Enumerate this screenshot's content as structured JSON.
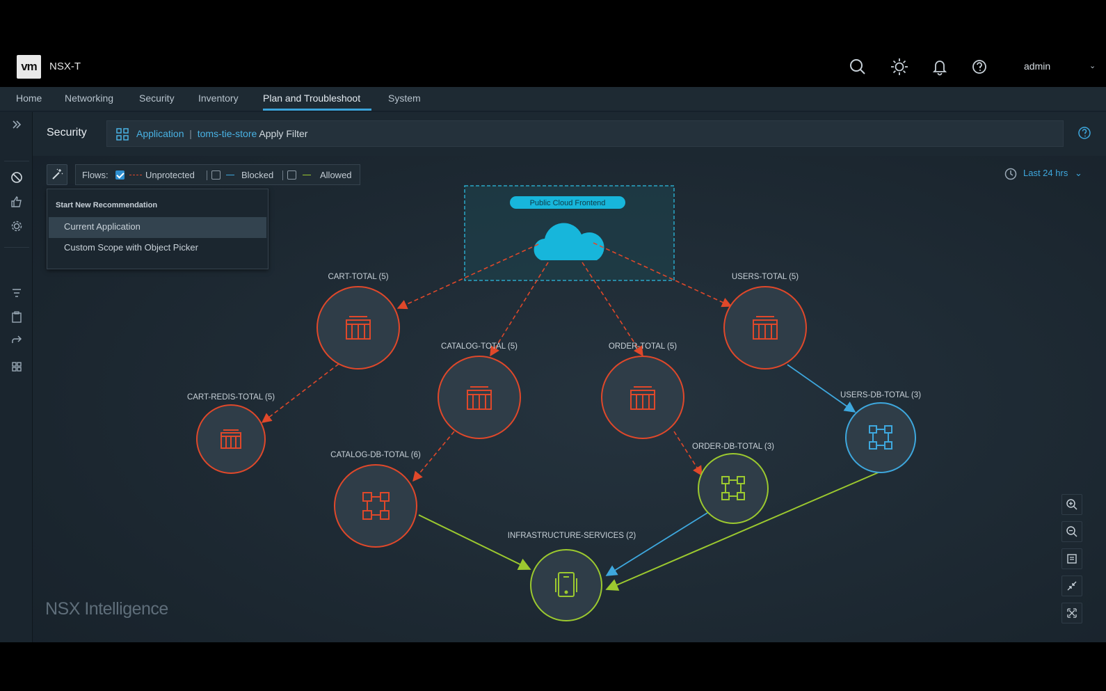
{
  "header": {
    "logo_text": "vm",
    "product": "NSX-T",
    "user": "admin",
    "icons": [
      "search-icon",
      "theme-icon",
      "bell-icon",
      "help-icon"
    ]
  },
  "nav": {
    "items": [
      {
        "label": "Home"
      },
      {
        "label": "Networking"
      },
      {
        "label": "Security"
      },
      {
        "label": "Inventory"
      },
      {
        "label": "Plan and Troubleshoot"
      },
      {
        "label": "System"
      }
    ],
    "active": "Plan and Troubleshoot"
  },
  "breadcrumb": {
    "title": "Security",
    "filter_application": "Application",
    "filter_value": "toms-tie-store",
    "apply_label": "Apply Filter"
  },
  "flows": {
    "label": "Flows:",
    "unprotected": {
      "label": "Unprotected",
      "checked": true,
      "color": "#e0482a"
    },
    "blocked": {
      "label": "Blocked",
      "checked": false,
      "color": "#3ea8de"
    },
    "allowed": {
      "label": "Allowed",
      "checked": false,
      "color": "#9cc92f"
    }
  },
  "time_range": "Last 24 hrs",
  "dropdown": {
    "header": "Start New Recommendation",
    "items": [
      {
        "label": "Current Application",
        "selected": true
      },
      {
        "label": "Custom Scope with Object Picker",
        "selected": false
      }
    ]
  },
  "graph": {
    "cloud_group_label": "Public Cloud Frontend",
    "nodes": [
      {
        "id": "cart",
        "label": "CART-TOTAL (5)",
        "kind": "vm",
        "status": "unprotected"
      },
      {
        "id": "users",
        "label": "USERS-TOTAL (5)",
        "kind": "vm",
        "status": "unprotected"
      },
      {
        "id": "catalog",
        "label": "CATALOG-TOTAL (5)",
        "kind": "vm",
        "status": "unprotected"
      },
      {
        "id": "order",
        "label": "ORDER-TOTAL (5)",
        "kind": "vm",
        "status": "unprotected"
      },
      {
        "id": "cartredis",
        "label": "CART-REDIS-TOTAL (5)",
        "kind": "vm",
        "status": "unprotected"
      },
      {
        "id": "usersdb",
        "label": "USERS-DB-TOTAL (3)",
        "kind": "group",
        "status": "blocked"
      },
      {
        "id": "orderdb",
        "label": "ORDER-DB-TOTAL (3)",
        "kind": "group",
        "status": "allowed"
      },
      {
        "id": "catalogdb",
        "label": "CATALOG-DB-TOTAL (6)",
        "kind": "group",
        "status": "unprotected"
      },
      {
        "id": "infra",
        "label": "INFRASTRUCTURE-SERVICES (2)",
        "kind": "device",
        "status": "allowed"
      }
    ]
  },
  "watermark": "NSX Intelligence",
  "colors": {
    "unprotected": "#e0482a",
    "blocked": "#3ea8de",
    "allowed": "#9cc92f",
    "accent": "#3ba3d9",
    "cloud": "#17b6db"
  }
}
